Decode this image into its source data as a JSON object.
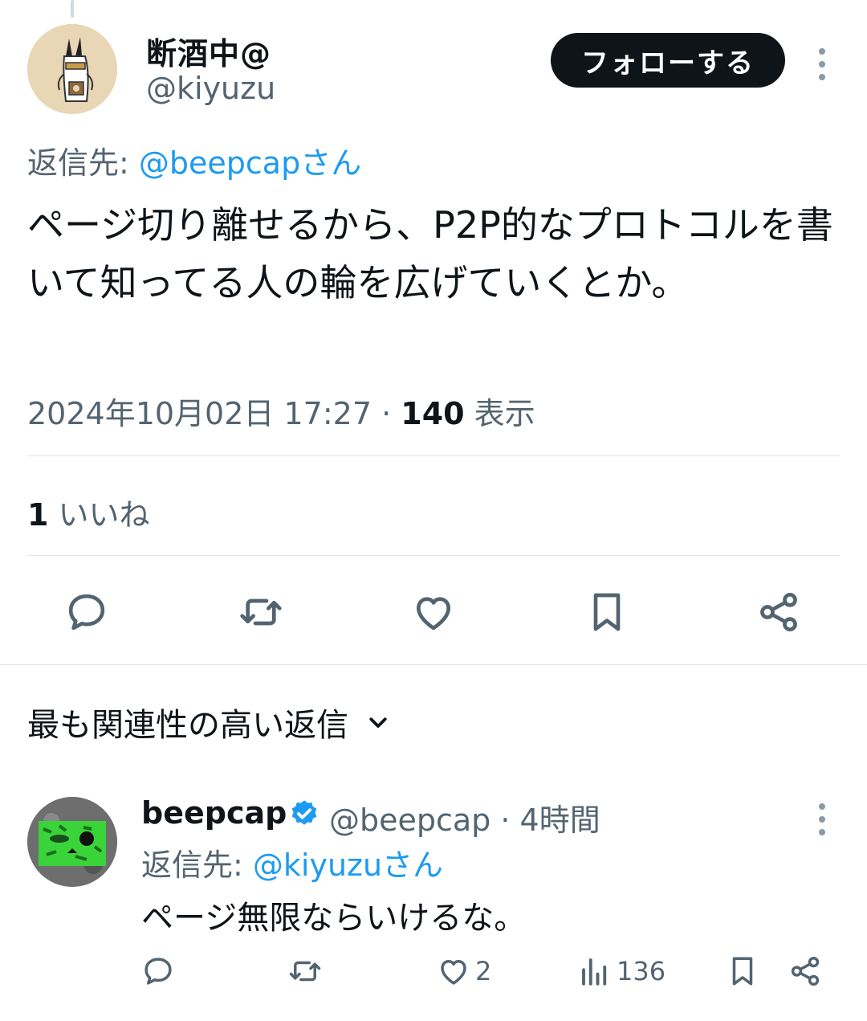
{
  "tweet": {
    "author": {
      "display_name": "断酒中@",
      "handle": "@kiyuzu",
      "avatar_icon": "rabbit-avatar-icon"
    },
    "follow_label": "フォローする",
    "reply_to_prefix": "返信先: ",
    "reply_to_mention": "@beepcapさん",
    "text": "ページ切り離せるから、P2P的なプロトコルを書いて知ってる人の輪を広げていくとか。",
    "timestamp": "2024年10月02日 17:27",
    "separator": " · ",
    "views_count": "140",
    "views_label": " 表示",
    "likes_count": "1",
    "likes_label": " いいね",
    "actions": [
      "reply-icon",
      "retweet-icon",
      "like-icon",
      "bookmark-icon",
      "share-icon"
    ]
  },
  "replies_section": {
    "sort_label": "最も関連性の高い返信"
  },
  "reply": {
    "author": {
      "display_name": "beepcap",
      "handle": "@beepcap",
      "verified": true,
      "avatar_icon": "box-face-avatar-icon"
    },
    "age": " · 4時間",
    "reply_to_prefix": "返信先: ",
    "reply_to_mention": "@kiyuzuさん",
    "text": "ページ無限ならいけるな。",
    "like_count": "2",
    "view_count": "136"
  },
  "colors": {
    "accent": "#1d9bf0",
    "text_primary": "#0f1419",
    "text_secondary": "#536471",
    "follow_button": "#0f1419"
  }
}
